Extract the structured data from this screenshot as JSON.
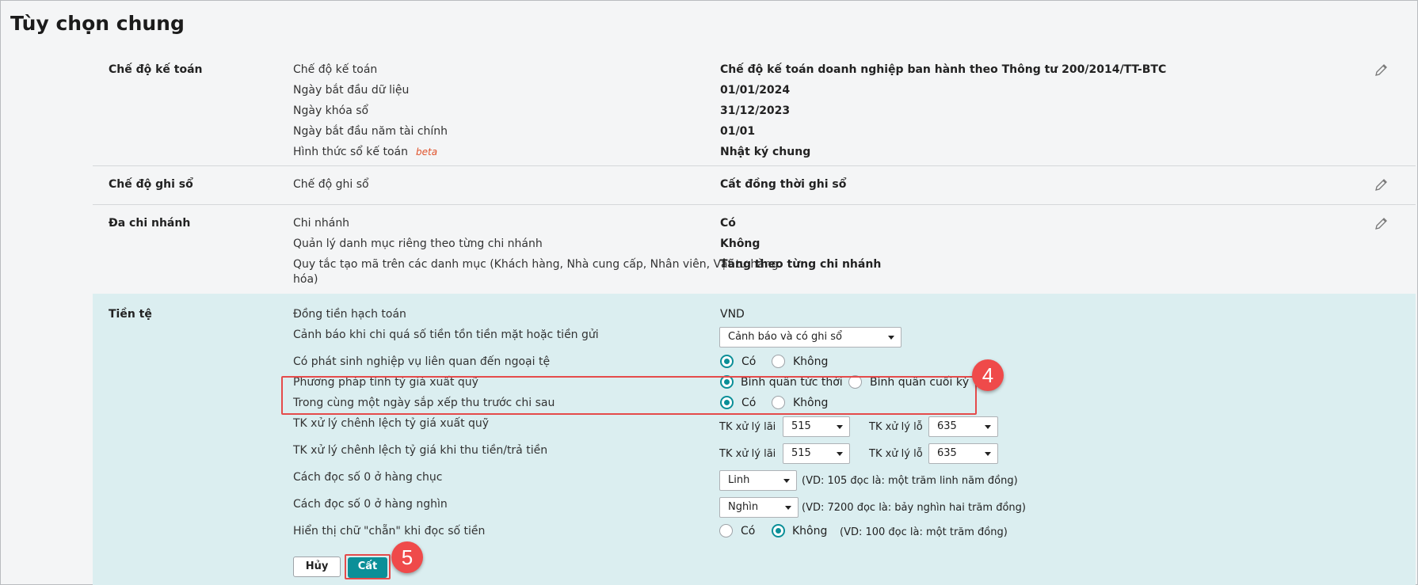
{
  "page_title": "Tùy chọn chung",
  "accounting_regime": {
    "section": "Chế độ kế toán",
    "rows": [
      {
        "label": "Chế độ kế toán",
        "value": "Chế độ kế toán doanh nghiệp ban hành theo Thông tư 200/2014/TT-BTC"
      },
      {
        "label": "Ngày bắt đầu dữ liệu",
        "value": "01/01/2024"
      },
      {
        "label": "Ngày khóa sổ",
        "value": "31/12/2023"
      },
      {
        "label": "Ngày bắt đầu năm tài chính",
        "value": "01/01"
      },
      {
        "label": "Hình thức sổ kế toán",
        "badge": "beta",
        "value": "Nhật ký chung"
      }
    ]
  },
  "posting_mode": {
    "section": "Chế độ ghi sổ",
    "rows": [
      {
        "label": "Chế độ ghi sổ",
        "value": "Cất đồng thời ghi sổ"
      }
    ]
  },
  "multi_branch": {
    "section": "Đa chi nhánh",
    "rows": [
      {
        "label": "Chi nhánh",
        "value": "Có"
      },
      {
        "label": "Quản lý danh mục riêng theo từng chi nhánh",
        "value": "Không"
      },
      {
        "label_line1": "Quy tắc tạo mã trên các danh mục (Khách hàng, Nhà cung cấp, Nhân viên, Vật tư hàng",
        "label_line2": "hóa)",
        "value": "Tăng theo từng chi nhánh"
      }
    ]
  },
  "currency": {
    "section": "Tiền tệ",
    "accounting_currency_label": "Đồng tiền hạch toán",
    "accounting_currency_value": "VND",
    "overspend_warning_label": "Cảnh báo khi chi quá số tiền tồn tiền mặt hoặc tiền gửi",
    "overspend_warning_value": "Cảnh báo và có ghi sổ",
    "foreign_ops_label": "Có phát sinh nghiệp vụ liên quan đến ngoại tệ",
    "option_yes": "Có",
    "option_no": "Không",
    "rate_method_label": "Phương pháp tính tỷ giá xuất quỹ",
    "rate_method_opt1": "Bình quân tức thời",
    "rate_method_opt2": "Bình quân cuối kỳ",
    "same_day_label": "Trong cùng một ngày sắp xếp thu trước chi sau",
    "fx_diff_outflow_label": "TK xử lý chênh lệch tỷ giá xuất quỹ",
    "fx_diff_payment_label": "TK xử lý chênh lệch tỷ giá khi thu tiền/trả tiền",
    "gain_account_label": "TK xử lý lãi",
    "loss_account_label": "TK xử lý lỗ",
    "gain_account_value": "515",
    "loss_account_value": "635",
    "tens_zero_label": "Cách đọc số 0 ở hàng chục",
    "tens_zero_value": "Linh",
    "tens_zero_example": "(VD: 105 đọc là: một trăm linh năm đồng)",
    "thousands_zero_label": "Cách đọc số 0 ở hàng nghìn",
    "thousands_zero_value": "Nghìn",
    "thousands_zero_example": "(VD: 7200 đọc là: bảy nghìn hai trăm đồng)",
    "even_word_label": "Hiển thị chữ \"chẵn\" khi đọc số tiền",
    "even_word_example": "(VD: 100 đọc là: một trăm đồng)"
  },
  "buttons": {
    "cancel": "Hủy",
    "save": "Cất"
  },
  "callouts": {
    "step4": "4",
    "step5": "5"
  },
  "colors": {
    "accent": "#0b8f98",
    "highlight": "#e54b4b",
    "currency_bg": "#dbeef0"
  }
}
